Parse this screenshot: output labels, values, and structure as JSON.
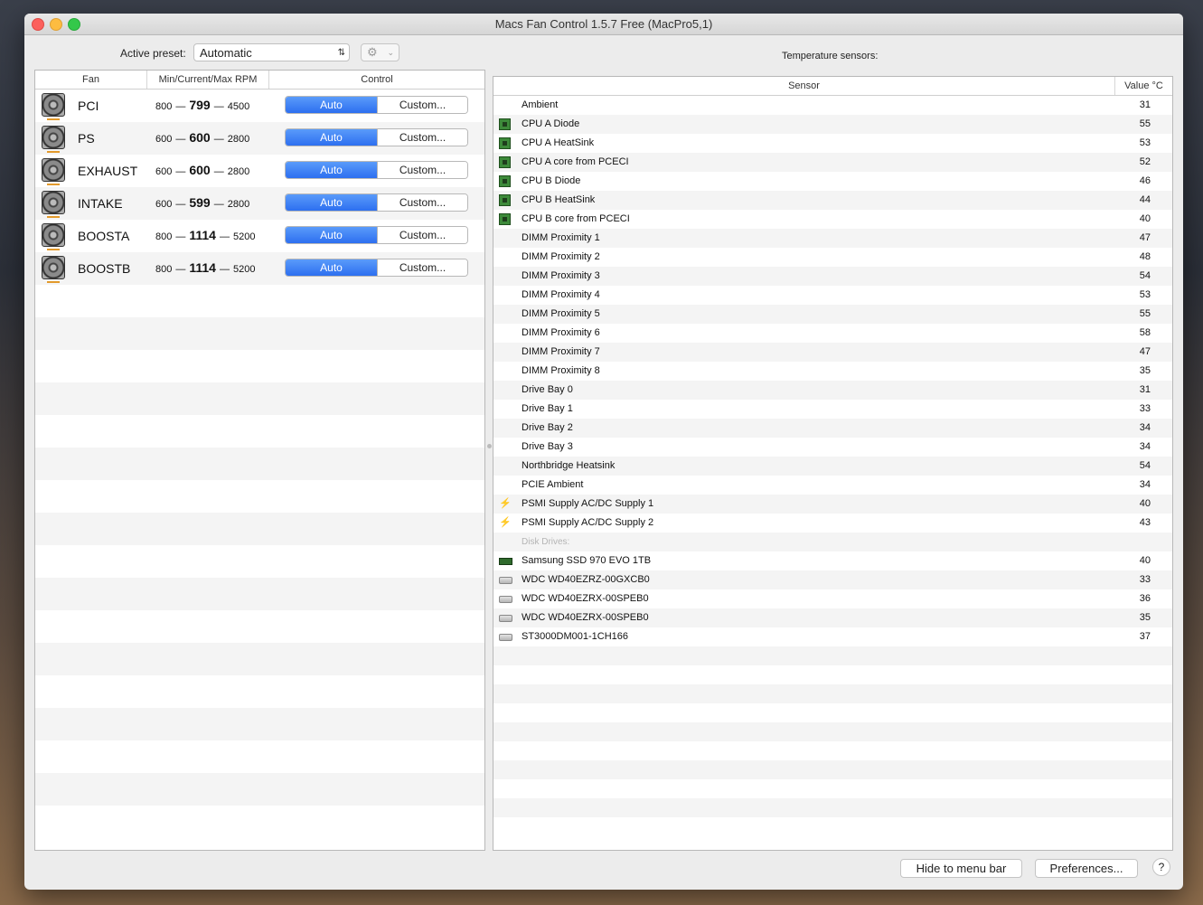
{
  "window": {
    "title": "Macs Fan Control 1.5.7 Free (MacPro5,1)"
  },
  "toolbar": {
    "preset_label": "Active preset:",
    "preset_value": "Automatic"
  },
  "fans": {
    "headers": {
      "fan": "Fan",
      "rpm": "Min/Current/Max RPM",
      "control": "Control"
    },
    "auto_label": "Auto",
    "custom_label": "Custom...",
    "rows": [
      {
        "name": "PCI",
        "min": "800",
        "current": "799",
        "max": "4500"
      },
      {
        "name": "PS",
        "min": "600",
        "current": "600",
        "max": "2800"
      },
      {
        "name": "EXHAUST",
        "min": "600",
        "current": "600",
        "max": "2800"
      },
      {
        "name": "INTAKE",
        "min": "600",
        "current": "599",
        "max": "2800"
      },
      {
        "name": "BOOSTA",
        "min": "800",
        "current": "1114",
        "max": "5200"
      },
      {
        "name": "BOOSTB",
        "min": "800",
        "current": "1114",
        "max": "5200"
      }
    ]
  },
  "sensors": {
    "title": "Temperature sensors:",
    "headers": {
      "sensor": "Sensor",
      "value": "Value °C"
    },
    "rows": [
      {
        "icon": "none",
        "name": "Ambient",
        "value": "31"
      },
      {
        "icon": "chip",
        "name": "CPU A Diode",
        "value": "55"
      },
      {
        "icon": "chip",
        "name": "CPU A HeatSink",
        "value": "53"
      },
      {
        "icon": "chip",
        "name": "CPU A core from PCECI",
        "value": "52"
      },
      {
        "icon": "chip",
        "name": "CPU B Diode",
        "value": "46"
      },
      {
        "icon": "chip",
        "name": "CPU B HeatSink",
        "value": "44"
      },
      {
        "icon": "chip",
        "name": "CPU B core from PCECI",
        "value": "40"
      },
      {
        "icon": "none",
        "name": "DIMM Proximity 1",
        "value": "47"
      },
      {
        "icon": "none",
        "name": "DIMM Proximity 2",
        "value": "48"
      },
      {
        "icon": "none",
        "name": "DIMM Proximity 3",
        "value": "54"
      },
      {
        "icon": "none",
        "name": "DIMM Proximity 4",
        "value": "53"
      },
      {
        "icon": "none",
        "name": "DIMM Proximity 5",
        "value": "55"
      },
      {
        "icon": "none",
        "name": "DIMM Proximity 6",
        "value": "58"
      },
      {
        "icon": "none",
        "name": "DIMM Proximity 7",
        "value": "47"
      },
      {
        "icon": "none",
        "name": "DIMM Proximity 8",
        "value": "35"
      },
      {
        "icon": "none",
        "name": "Drive Bay 0",
        "value": "31"
      },
      {
        "icon": "none",
        "name": "Drive Bay 1",
        "value": "33"
      },
      {
        "icon": "none",
        "name": "Drive Bay 2",
        "value": "34"
      },
      {
        "icon": "none",
        "name": "Drive Bay 3",
        "value": "34"
      },
      {
        "icon": "none",
        "name": "Northbridge Heatsink",
        "value": "54"
      },
      {
        "icon": "none",
        "name": "PCIE Ambient",
        "value": "34"
      },
      {
        "icon": "bolt",
        "name": "PSMI Supply AC/DC Supply 1",
        "value": "40"
      },
      {
        "icon": "bolt",
        "name": "PSMI Supply AC/DC Supply 2",
        "value": "43"
      },
      {
        "icon": "section",
        "name": "Disk Drives:",
        "value": ""
      },
      {
        "icon": "ssd",
        "name": "Samsung SSD 970 EVO 1TB",
        "value": "40"
      },
      {
        "icon": "hdd",
        "name": "WDC WD40EZRZ-00GXCB0",
        "value": "33"
      },
      {
        "icon": "hdd",
        "name": "WDC WD40EZRX-00SPEB0",
        "value": "36"
      },
      {
        "icon": "hdd",
        "name": "WDC WD40EZRX-00SPEB0",
        "value": "35"
      },
      {
        "icon": "hdd",
        "name": "ST3000DM001-1CH166",
        "value": "37"
      }
    ]
  },
  "footer": {
    "hide_label": "Hide to menu bar",
    "prefs_label": "Preferences...",
    "help_label": "?"
  }
}
